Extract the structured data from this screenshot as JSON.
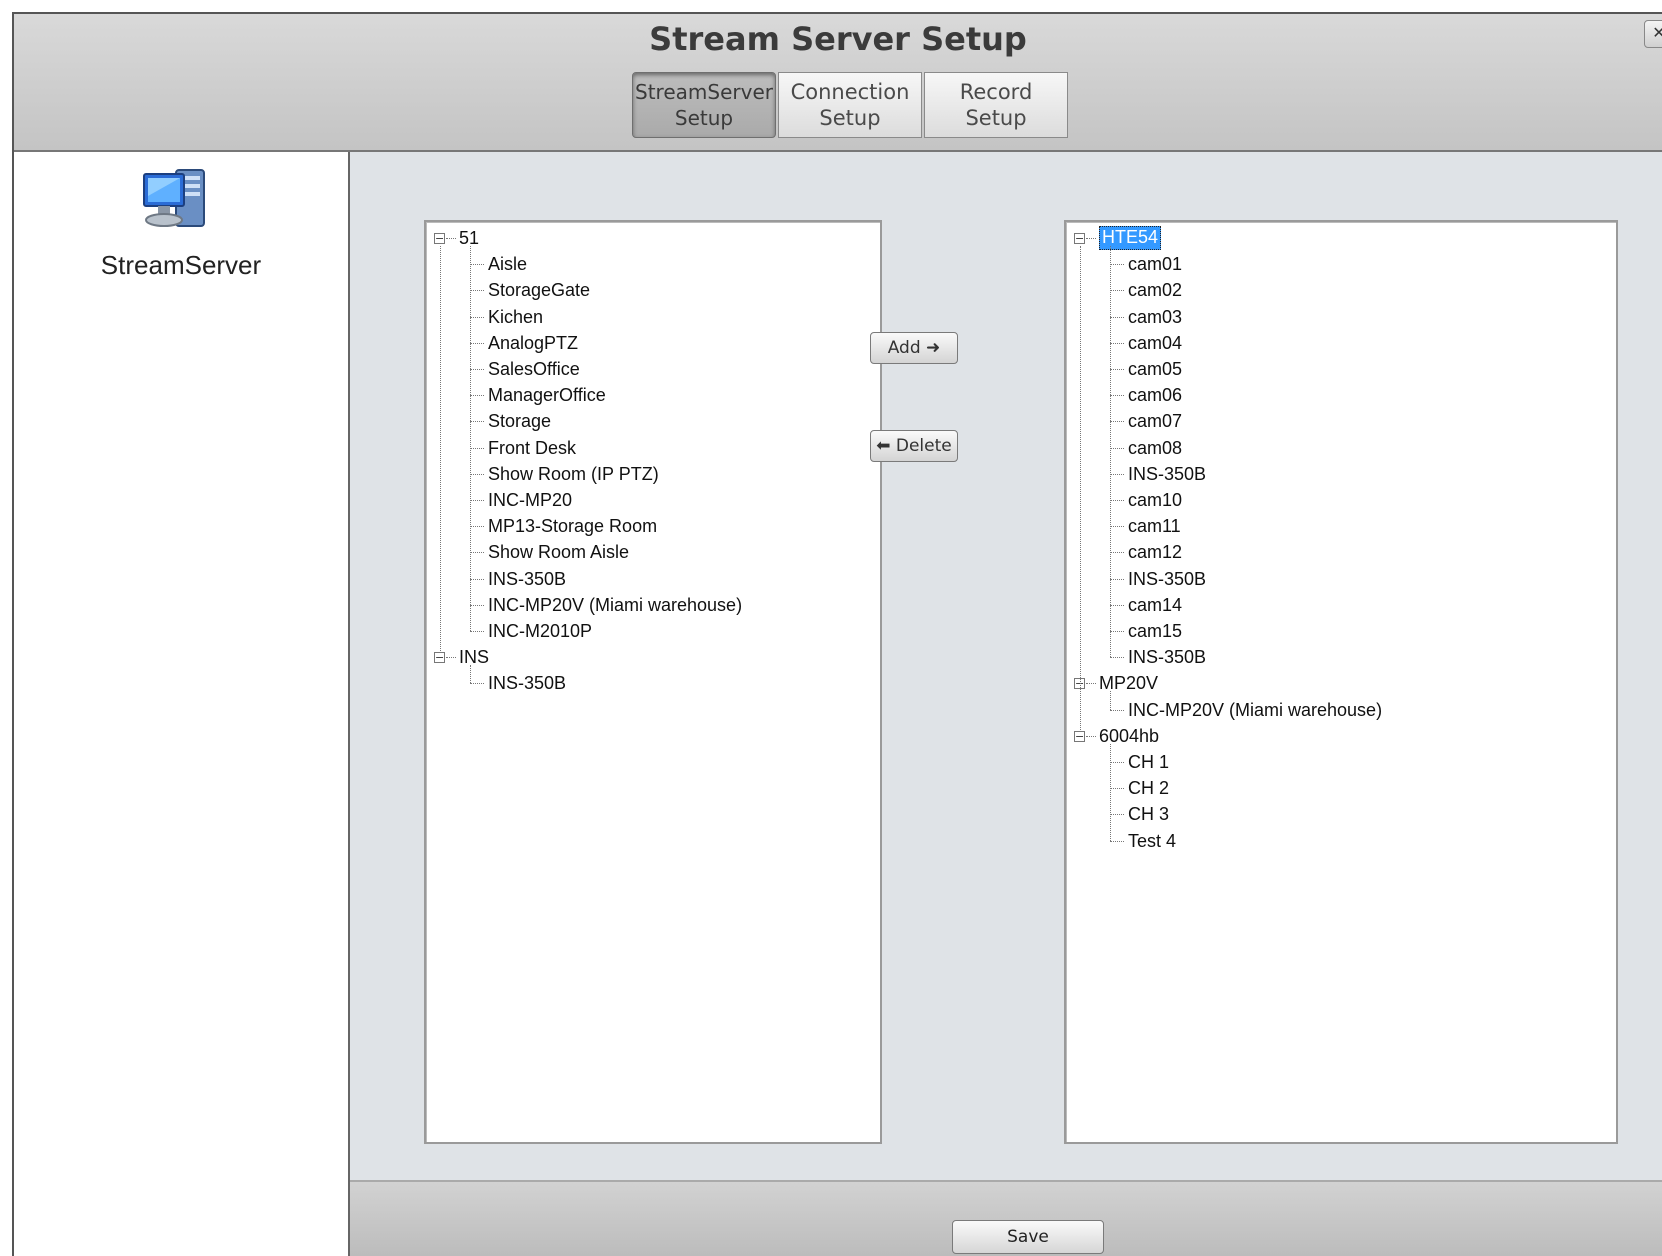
{
  "window": {
    "title": "Stream Server Setup",
    "close_glyph": "✕"
  },
  "tabs": [
    {
      "label": "StreamServer\nSetup",
      "active": true
    },
    {
      "label": "Connection\nSetup",
      "active": false
    },
    {
      "label": "Record\nSetup",
      "active": false
    }
  ],
  "sidebar": {
    "item_label": "StreamServer",
    "icon": "computer-server-icon"
  },
  "left_tree": {
    "groups": [
      {
        "label": "51",
        "expanded": true,
        "children": [
          "Aisle",
          "StorageGate",
          "Kichen",
          "AnalogPTZ",
          "SalesOffice",
          "ManagerOffice",
          "Storage",
          "Front Desk",
          "Show Room (IP PTZ)",
          "INC-MP20",
          "MP13-Storage Room",
          "Show Room Aisle",
          "INS-350B",
          "INC-MP20V (Miami warehouse)",
          "INC-M2010P"
        ]
      },
      {
        "label": "INS",
        "expanded": true,
        "children": [
          "INS-350B"
        ]
      }
    ]
  },
  "right_tree": {
    "selected": "HTE54",
    "groups": [
      {
        "label": "HTE54",
        "expanded": true,
        "children": [
          "cam01",
          "cam02",
          "cam03",
          "cam04",
          "cam05",
          "cam06",
          "cam07",
          "cam08",
          "INS-350B",
          "cam10",
          "cam11",
          "cam12",
          "INS-350B",
          "cam14",
          "cam15",
          "INS-350B"
        ]
      },
      {
        "label": "MP20V",
        "expanded": true,
        "children": [
          "INC-MP20V (Miami warehouse)"
        ]
      },
      {
        "label": "6004hb",
        "expanded": true,
        "children": [
          "CH 1",
          "CH 2",
          "CH 3",
          "Test 4"
        ]
      }
    ]
  },
  "buttons": {
    "add": "Add ➜",
    "delete": "⬅ Delete",
    "save": "Save"
  },
  "colors": {
    "selection": "#3399ff",
    "panel_bg": "#dfe3e7",
    "header_bg": "#cfcfcf"
  }
}
